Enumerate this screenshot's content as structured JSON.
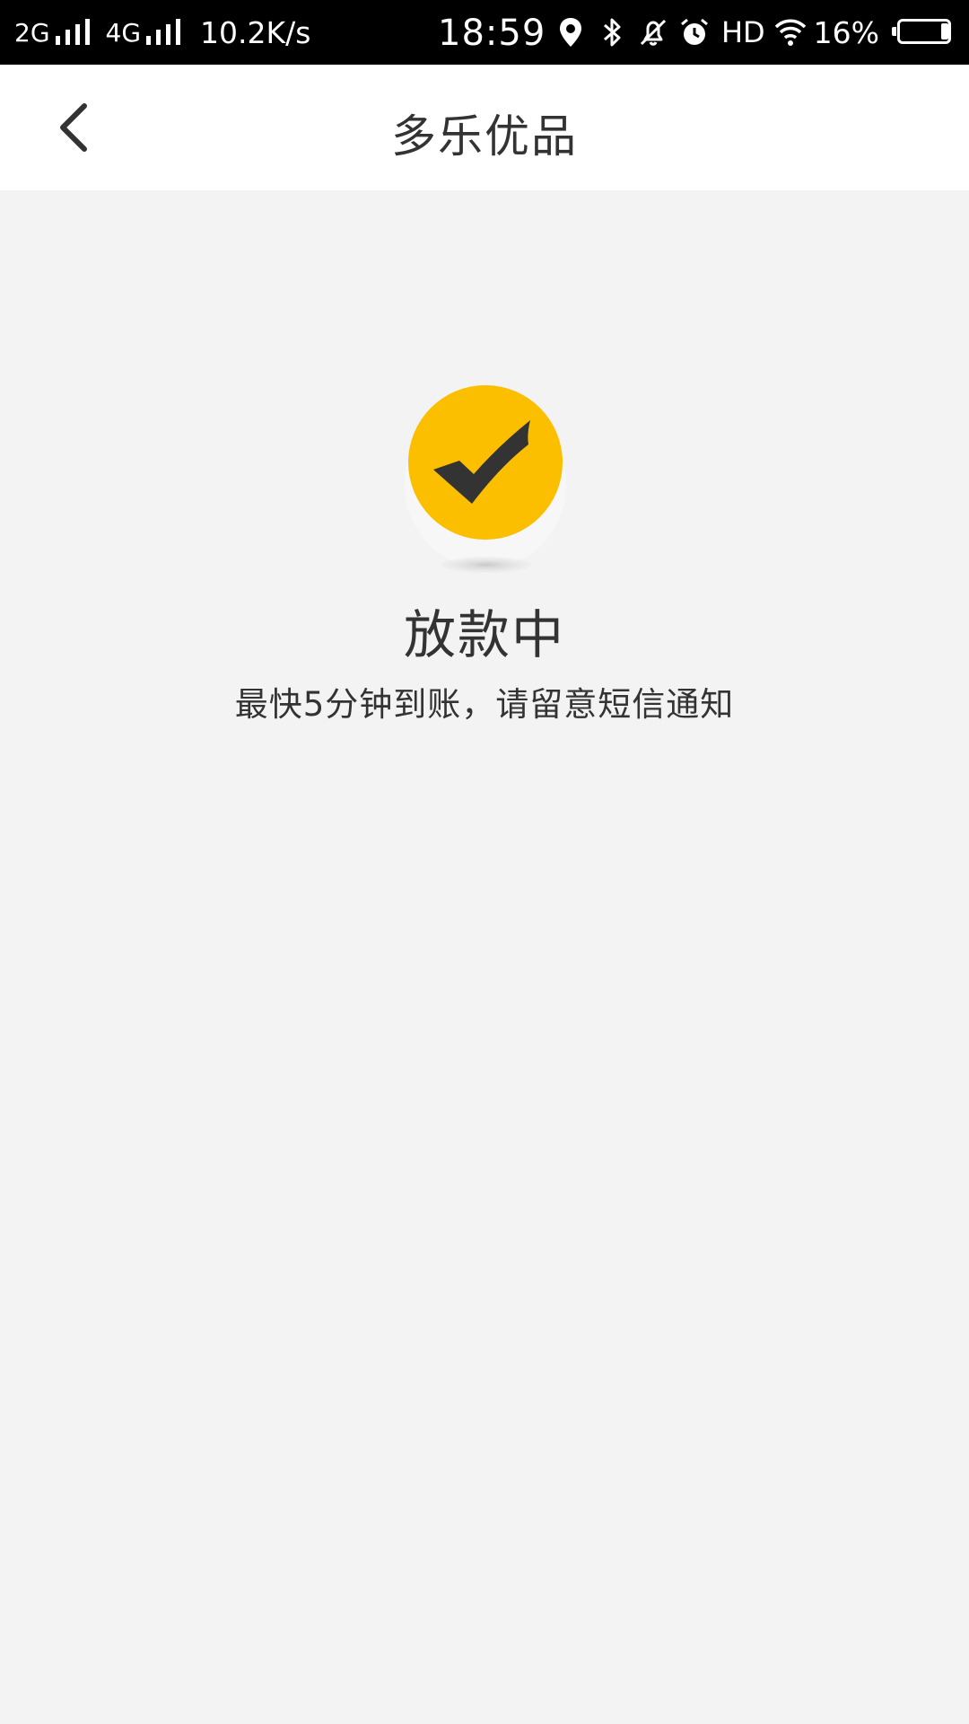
{
  "status_bar": {
    "network_1": "2G",
    "network_2": "4G",
    "speed": "10.2K/s",
    "time": "18:59",
    "hd": "HD",
    "battery_percent": "16%",
    "battery_level": 0.16,
    "icons": [
      "signal-icon",
      "signal-icon",
      "location-icon",
      "bluetooth-icon",
      "bell-muted-icon",
      "alarm-icon",
      "wifi-icon",
      "battery-icon"
    ]
  },
  "header": {
    "title": "多乐优品",
    "back_icon": "chevron-left-icon"
  },
  "main": {
    "status_icon": "check-circle-icon",
    "status_title": "放款中",
    "status_message": "最快5分钟到账，请留意短信通知"
  },
  "colors": {
    "accent": "#fbbf00",
    "check": "#333333",
    "background": "#f3f3f3",
    "header_bg": "#ffffff",
    "status_bar_bg": "#000000"
  }
}
